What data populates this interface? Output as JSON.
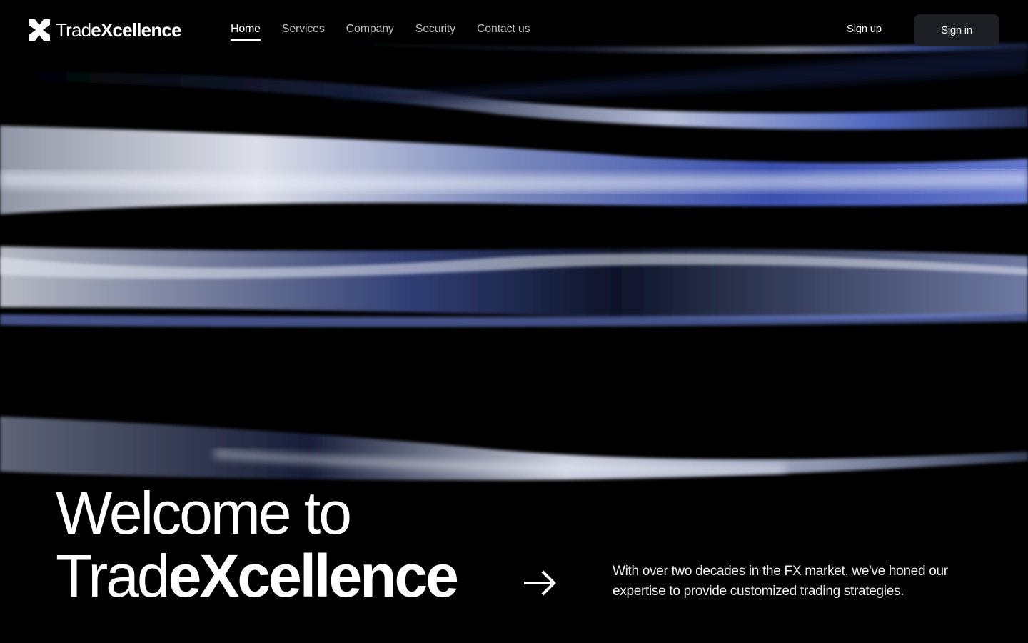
{
  "brand": {
    "name_light": "Trad",
    "name_bold": "eXcellence",
    "logo_icon": "x-logo-icon"
  },
  "nav": {
    "items": [
      {
        "label": "Home",
        "active": true
      },
      {
        "label": "Services",
        "active": false
      },
      {
        "label": "Company",
        "active": false
      },
      {
        "label": "Security",
        "active": false
      },
      {
        "label": "Contact us",
        "active": false
      }
    ]
  },
  "auth": {
    "signup_label": "Sign up",
    "signin_label": "Sign in"
  },
  "hero": {
    "line1": "Welcome to",
    "line2_light": "Trad",
    "line2_bold": "eXcellence",
    "arrow_icon": "arrow-right-icon",
    "tagline": "With over two decades in the FX market, we've honed our expertise to provide customized trading strategies."
  },
  "colors": {
    "background": "#000000",
    "accent": "#4a62c8",
    "button_bg": "#1d1f24",
    "nav_inactive": "#bdbdbd"
  }
}
